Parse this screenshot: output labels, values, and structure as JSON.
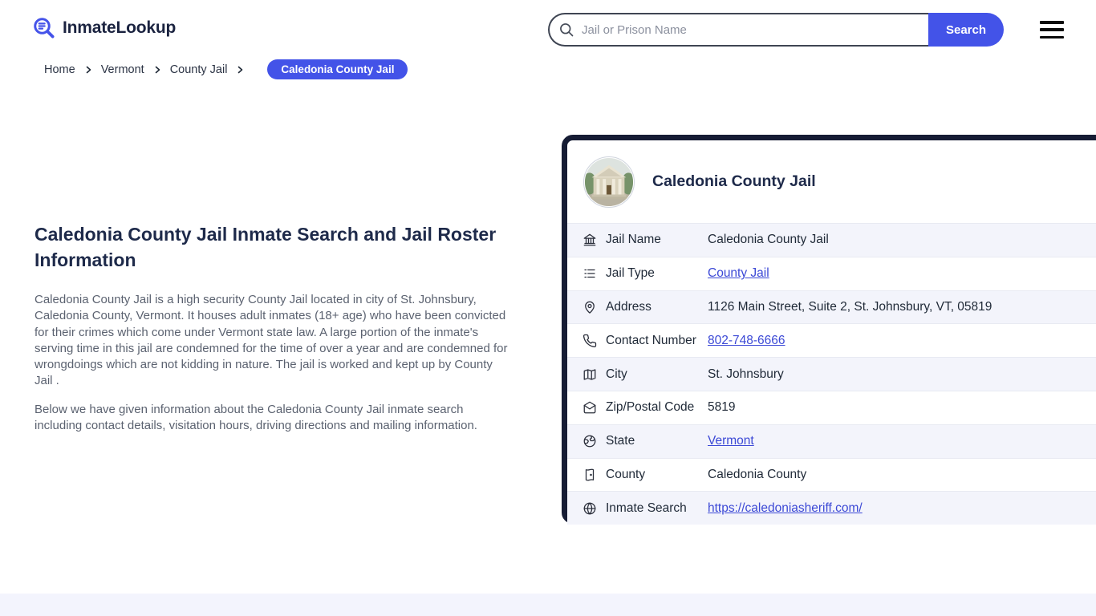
{
  "brand": {
    "name": "InmateLookup"
  },
  "search": {
    "placeholder": "Jail or Prison Name",
    "button_label": "Search"
  },
  "breadcrumb": {
    "items": [
      "Home",
      "Vermont",
      "County Jail"
    ],
    "current": "Caledonia County Jail"
  },
  "article": {
    "heading": "Caledonia County Jail Inmate Search and Jail Roster Information",
    "paragraph1": "Caledonia County Jail is a high security County Jail located in city of St. Johnsbury, Caledonia County, Vermont. It houses adult inmates (18+ age) who have been convicted for their crimes which come under Vermont state law. A large portion of the inmate's serving time in this jail are condemned for the time of over a year and are condemned for wrongdoings which are not kidding in nature. The jail is worked and kept up by County Jail .",
    "paragraph2": "Below we have given information about the Caledonia County Jail inmate search including contact details, visitation hours, driving directions and mailing information."
  },
  "card": {
    "title": "Caledonia County Jail",
    "rows": [
      {
        "icon": "bank-icon",
        "label": "Jail Name",
        "value": "Caledonia County Jail",
        "link": false
      },
      {
        "icon": "list-icon",
        "label": "Jail Type",
        "value": "County Jail",
        "link": true
      },
      {
        "icon": "map-pin-icon",
        "label": "Address",
        "value": "1126 Main Street, Suite 2, St. Johnsbury, VT, 05819",
        "link": false
      },
      {
        "icon": "phone-icon",
        "label": "Contact Number",
        "value": "802-748-6666",
        "link": true
      },
      {
        "icon": "map-icon",
        "label": "City",
        "value": "St. Johnsbury",
        "link": false
      },
      {
        "icon": "mail-icon",
        "label": "Zip/Postal Code",
        "value": "5819",
        "link": false
      },
      {
        "icon": "earth-icon",
        "label": "State",
        "value": "Vermont",
        "link": true
      },
      {
        "icon": "flag-icon",
        "label": "County",
        "value": "Caledonia County",
        "link": false
      },
      {
        "icon": "globe-icon",
        "label": "Inmate Search",
        "value": "https://caledoniasheriff.com/",
        "link": true
      }
    ]
  },
  "colors": {
    "accent": "#4353e8",
    "navy": "#161c34",
    "row_alt": "#f3f4fb",
    "link": "#3c49d6",
    "heading": "#1e2a4a",
    "body_text": "#5b6270"
  }
}
